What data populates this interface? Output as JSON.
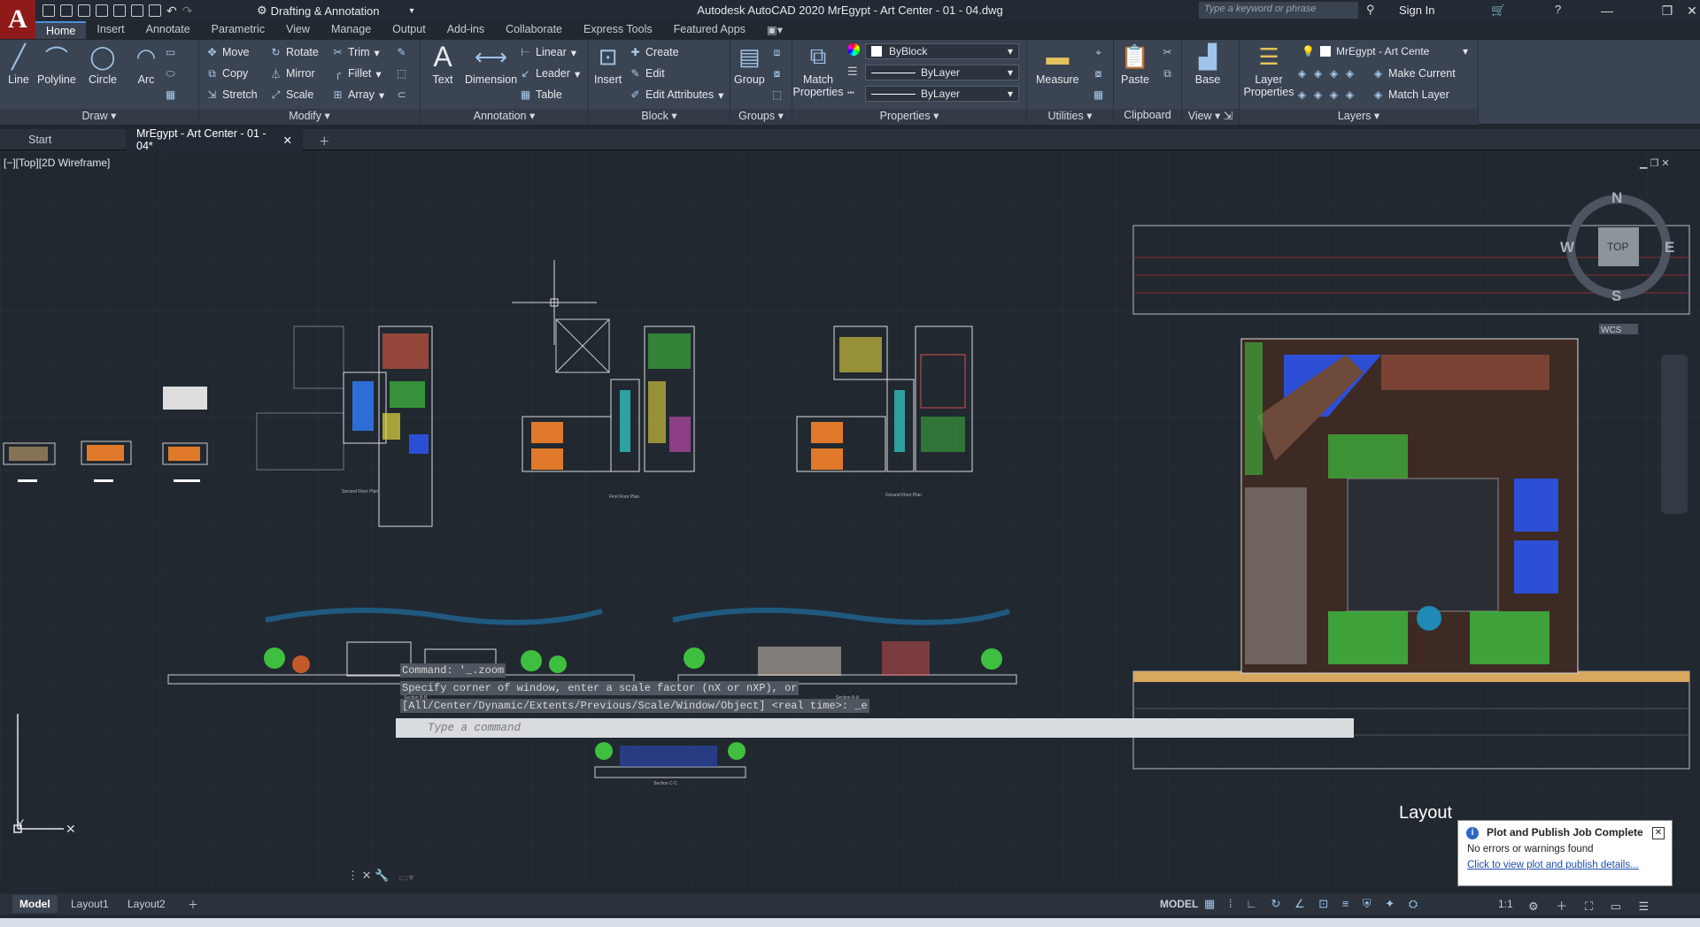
{
  "app": {
    "title": "Autodesk AutoCAD 2020    MrEgypt - Art Center - 01 - 04.dwg",
    "workspace": "Drafting & Annotation",
    "search_placeholder": "Type a keyword or phrase",
    "sign_in": "Sign In"
  },
  "ribbon_tabs": [
    "Home",
    "Insert",
    "Annotate",
    "Parametric",
    "View",
    "Manage",
    "Output",
    "Add-ins",
    "Collaborate",
    "Express Tools",
    "Featured Apps"
  ],
  "panels": {
    "draw": {
      "title": "Draw",
      "tools": [
        "Line",
        "Polyline",
        "Circle",
        "Arc"
      ]
    },
    "modify": {
      "title": "Modify",
      "row1": [
        "Move",
        "Rotate",
        "Trim"
      ],
      "row2": [
        "Copy",
        "Mirror",
        "Fillet"
      ],
      "row3": [
        "Stretch",
        "Scale",
        "Array"
      ]
    },
    "annotation": {
      "title": "Annotation",
      "big": [
        "Text",
        "Dimension"
      ],
      "small": [
        "Linear",
        "Leader",
        "Table"
      ]
    },
    "block": {
      "title": "Block",
      "big": "Insert",
      "small": [
        "Create",
        "Edit",
        "Edit Attributes"
      ]
    },
    "groups": {
      "title": "Groups",
      "big": "Group"
    },
    "properties": {
      "title": "Properties",
      "big": "Match Properties",
      "color": "ByBlock",
      "linetype": "ByLayer",
      "lineweight": "ByLayer"
    },
    "utilities": {
      "title": "Utilities",
      "big": "Measure"
    },
    "clipboard": {
      "title": "Clipboard",
      "big": "Paste"
    },
    "view": {
      "title": "View",
      "big": "Base"
    },
    "layers": {
      "title": "Layers",
      "big": "Layer Properties",
      "current_layer": "MrEgypt - Art Cente",
      "make_current": "Make Current",
      "match_layer": "Match Layer"
    }
  },
  "doc_tabs": [
    "Start",
    "MrEgypt - Art Center - 01 - 04*"
  ],
  "viewport_label": "[−][Top][2D Wireframe]",
  "viewcube": {
    "n": "N",
    "s": "S",
    "e": "E",
    "w": "W",
    "top": "TOP",
    "wcs": "WCS"
  },
  "drawing_labels": {
    "second_floor": "Second Floor Plan",
    "first_floor": "First Floor Plan",
    "ground_floor": "Ground Floor Plan",
    "section_bb": "Section B-B",
    "section_aa": "Section A-A",
    "section_cc": "Section C-C",
    "layout": "Layout"
  },
  "command_history": [
    "Command: '_.zoom",
    "Specify corner of window, enter a scale factor (nX or nXP), or",
    "[All/Center/Dynamic/Extents/Previous/Scale/Window/Object] <real time>: _e"
  ],
  "command_placeholder": "Type a command",
  "notification": {
    "title": "Plot and Publish Job Complete",
    "body": "No errors or warnings found",
    "link": "Click to view plot and publish details..."
  },
  "status": {
    "layout_tabs": [
      "Model",
      "Layout1",
      "Layout2"
    ],
    "model": "MODEL",
    "scale": "1:1"
  },
  "colors": {
    "accent": "#4a90d9",
    "canvas": "#212830",
    "ribbon": "#3b4452",
    "logo": "#8e1a1a"
  }
}
